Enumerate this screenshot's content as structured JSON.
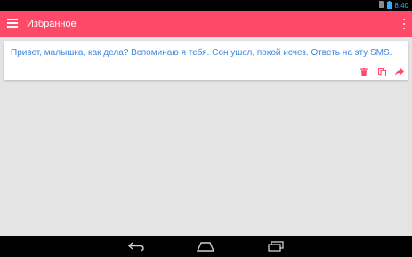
{
  "status_bar": {
    "time": "8:40",
    "icons": [
      "sim-icon",
      "battery-icon"
    ]
  },
  "app_bar": {
    "title": "Избранное",
    "menu_icon": "hamburger-icon",
    "overflow_icon": "more-vert-icon",
    "background_color": "#fe4a68"
  },
  "favorites": [
    {
      "text": "Привет, малышка, как дела? Вспоминаю я тебя. Сон ушел, покой исчез. Ответь на эту SMS.",
      "text_color": "#3f85e0",
      "actions": [
        "delete-icon",
        "copy-icon",
        "share-icon"
      ]
    }
  ],
  "nav_bar": {
    "buttons": [
      "back-icon",
      "home-icon",
      "recents-icon"
    ]
  },
  "colors": {
    "accent": "#fe4a68",
    "message_text": "#3f85e0",
    "background": "#e4e4e4"
  }
}
